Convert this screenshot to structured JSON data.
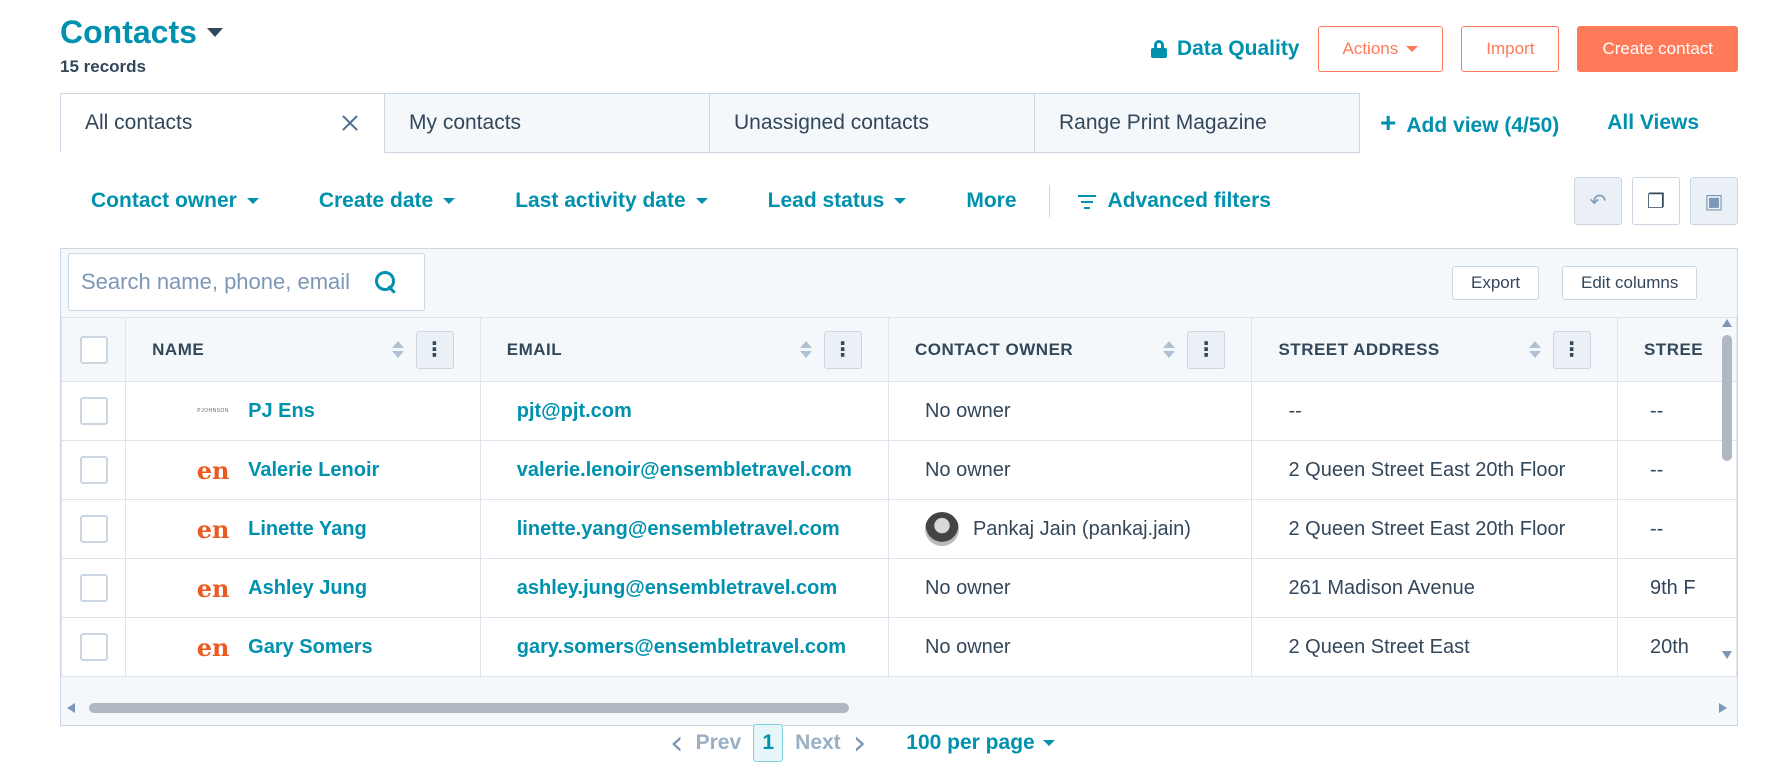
{
  "header": {
    "title": "Contacts",
    "record_count": "15 records"
  },
  "top_actions": {
    "data_quality": "Data Quality",
    "actions": "Actions",
    "import": "Import",
    "create_contact": "Create contact"
  },
  "tabs": [
    {
      "label": "All contacts"
    },
    {
      "label": "My contacts"
    },
    {
      "label": "Unassigned contacts"
    },
    {
      "label": "Range Print Magazine"
    }
  ],
  "tab_links": {
    "add_view": "Add view (4/50)",
    "all_views": "All Views"
  },
  "filters": {
    "contact_owner": "Contact owner",
    "create_date": "Create date",
    "last_activity_date": "Last activity date",
    "lead_status": "Lead status",
    "more": "More",
    "advanced_filters": "Advanced filters"
  },
  "table_toolbar": {
    "search_placeholder": "Search name, phone, email",
    "export": "Export",
    "edit_columns": "Edit columns"
  },
  "columns": [
    "NAME",
    "EMAIL",
    "CONTACT OWNER",
    "STREET ADDRESS",
    "STREE"
  ],
  "rows": [
    {
      "logo": "PJOHNSON",
      "name": "PJ Ens",
      "email": "pjt@pjt.com",
      "owner": "No owner",
      "street": "--",
      "street2": "--"
    },
    {
      "logo": "en",
      "name": "Valerie Lenoir",
      "email": "valerie.lenoir@ensembletravel.com",
      "owner": "No owner",
      "street": "2 Queen Street East 20th Floor",
      "street2": "--"
    },
    {
      "logo": "en",
      "name": "Linette Yang",
      "email": "linette.yang@ensembletravel.com",
      "owner": "Pankaj Jain (pankaj.jain)",
      "street": "2 Queen Street East 20th Floor",
      "street2": "--"
    },
    {
      "logo": "en",
      "name": "Ashley Jung",
      "email": "ashley.jung@ensembletravel.com",
      "owner": "No owner",
      "street": "261 Madison Avenue",
      "street2": "9th F"
    },
    {
      "logo": "en",
      "name": "Gary Somers",
      "email": "gary.somers@ensembletravel.com",
      "owner": "No owner",
      "street": "2 Queen Street East",
      "street2": "20th"
    }
  ],
  "pagination": {
    "prev": "Prev",
    "current": "1",
    "next": "Next",
    "per_page": "100 per page"
  },
  "colors": {
    "accent": "#0091ae",
    "primary_button": "#ff7a59",
    "logo_orange": "#ea5b22"
  }
}
